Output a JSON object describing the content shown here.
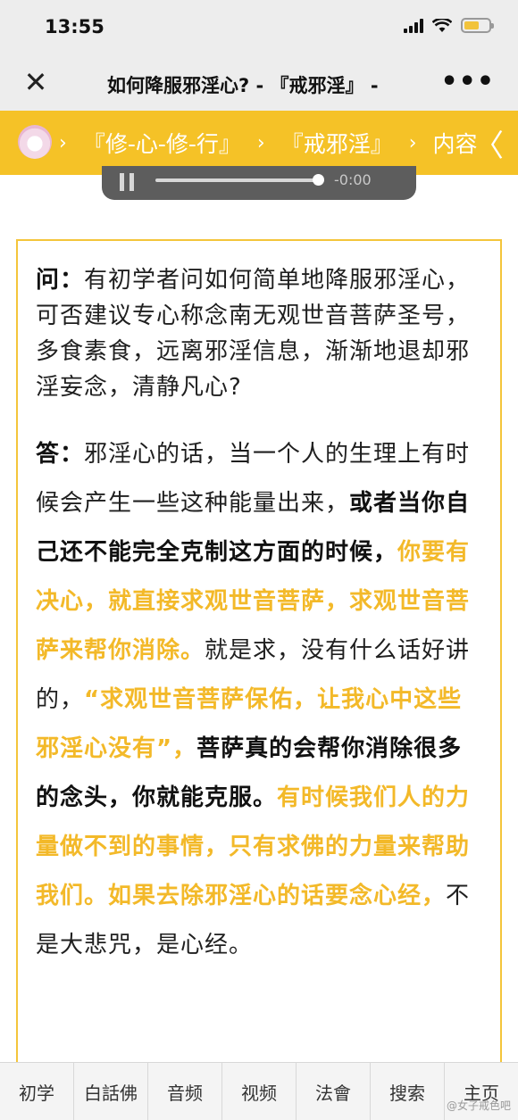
{
  "status_bar": {
    "time": "13:55"
  },
  "nav": {
    "title": "如何降服邪淫心? - 『戒邪淫』 -",
    "close_icon": "close-icon",
    "more": "•••"
  },
  "breadcrumb": {
    "items": [
      "『修-心-修-行』",
      "『戒邪淫』",
      "内容"
    ],
    "back": "〈"
  },
  "audio": {
    "time": "-0:00",
    "progress": 0.98
  },
  "article": {
    "q_label": "问：",
    "q_text": "有初学者问如何简单地降服邪淫心，可否建议专心称念南无观世音菩萨圣号，多食素食，远离邪淫信息，渐渐地退却邪淫妄念，清静凡心?",
    "a_label": "答：",
    "a_parts": [
      {
        "style": "normal",
        "text": "邪淫心的话，当一个人的生理上有时候会产生一些这种能量出来，"
      },
      {
        "style": "bold",
        "text": "或者当你自己还不能完全克制这方面的时候，"
      },
      {
        "style": "yellow",
        "text": "你要有决心，就直接求观世音菩萨，求观世音菩萨来帮你消除。"
      },
      {
        "style": "normal",
        "text": "就是求，没有什么话好讲的，"
      },
      {
        "style": "yellow",
        "text": "“求观世音菩萨保佑，让我心中这些邪淫心没有”，"
      },
      {
        "style": "bold",
        "text": "菩萨真的会帮你消除很多的念头，你就能克服。"
      },
      {
        "style": "yellow",
        "text": "有时候我们人的力量做不到的事情，只有求佛的力量来帮助我们。如果去除邪淫心的话要念心经，"
      },
      {
        "style": "normal",
        "text": "不是大悲咒，是心经。"
      }
    ]
  },
  "tabs": [
    "初学",
    "白話佛",
    "音频",
    "视频",
    "法會",
    "搜索",
    "主页"
  ],
  "watermark": "@女子戒色吧",
  "colors": {
    "accent_yellow": "#f5c227",
    "highlight_text": "#f3b929"
  }
}
